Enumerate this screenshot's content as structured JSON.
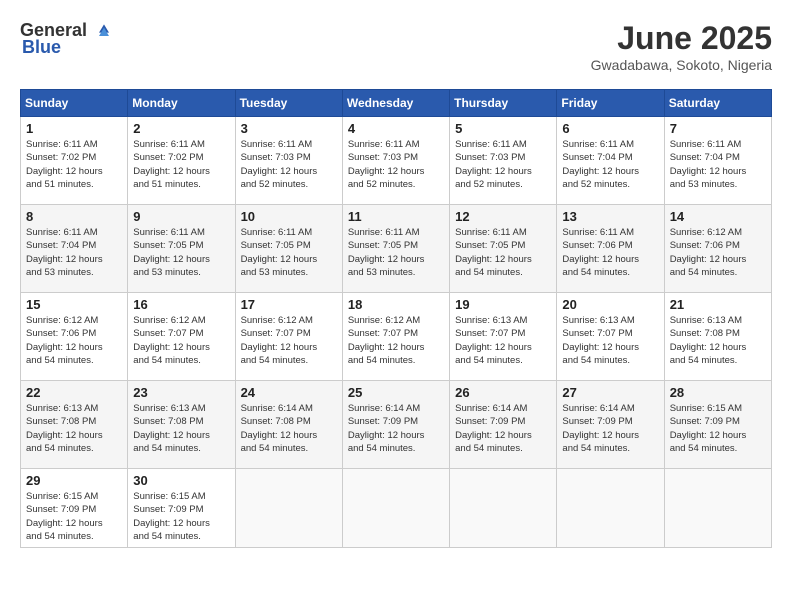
{
  "logo": {
    "general": "General",
    "blue": "Blue"
  },
  "title": "June 2025",
  "location": "Gwadabawa, Sokoto, Nigeria",
  "weekdays": [
    "Sunday",
    "Monday",
    "Tuesday",
    "Wednesday",
    "Thursday",
    "Friday",
    "Saturday"
  ],
  "weeks": [
    [
      {
        "day": "1",
        "info": "Sunrise: 6:11 AM\nSunset: 7:02 PM\nDaylight: 12 hours\nand 51 minutes."
      },
      {
        "day": "2",
        "info": "Sunrise: 6:11 AM\nSunset: 7:02 PM\nDaylight: 12 hours\nand 51 minutes."
      },
      {
        "day": "3",
        "info": "Sunrise: 6:11 AM\nSunset: 7:03 PM\nDaylight: 12 hours\nand 52 minutes."
      },
      {
        "day": "4",
        "info": "Sunrise: 6:11 AM\nSunset: 7:03 PM\nDaylight: 12 hours\nand 52 minutes."
      },
      {
        "day": "5",
        "info": "Sunrise: 6:11 AM\nSunset: 7:03 PM\nDaylight: 12 hours\nand 52 minutes."
      },
      {
        "day": "6",
        "info": "Sunrise: 6:11 AM\nSunset: 7:04 PM\nDaylight: 12 hours\nand 52 minutes."
      },
      {
        "day": "7",
        "info": "Sunrise: 6:11 AM\nSunset: 7:04 PM\nDaylight: 12 hours\nand 53 minutes."
      }
    ],
    [
      {
        "day": "8",
        "info": "Sunrise: 6:11 AM\nSunset: 7:04 PM\nDaylight: 12 hours\nand 53 minutes."
      },
      {
        "day": "9",
        "info": "Sunrise: 6:11 AM\nSunset: 7:05 PM\nDaylight: 12 hours\nand 53 minutes."
      },
      {
        "day": "10",
        "info": "Sunrise: 6:11 AM\nSunset: 7:05 PM\nDaylight: 12 hours\nand 53 minutes."
      },
      {
        "day": "11",
        "info": "Sunrise: 6:11 AM\nSunset: 7:05 PM\nDaylight: 12 hours\nand 53 minutes."
      },
      {
        "day": "12",
        "info": "Sunrise: 6:11 AM\nSunset: 7:05 PM\nDaylight: 12 hours\nand 54 minutes."
      },
      {
        "day": "13",
        "info": "Sunrise: 6:11 AM\nSunset: 7:06 PM\nDaylight: 12 hours\nand 54 minutes."
      },
      {
        "day": "14",
        "info": "Sunrise: 6:12 AM\nSunset: 7:06 PM\nDaylight: 12 hours\nand 54 minutes."
      }
    ],
    [
      {
        "day": "15",
        "info": "Sunrise: 6:12 AM\nSunset: 7:06 PM\nDaylight: 12 hours\nand 54 minutes."
      },
      {
        "day": "16",
        "info": "Sunrise: 6:12 AM\nSunset: 7:07 PM\nDaylight: 12 hours\nand 54 minutes."
      },
      {
        "day": "17",
        "info": "Sunrise: 6:12 AM\nSunset: 7:07 PM\nDaylight: 12 hours\nand 54 minutes."
      },
      {
        "day": "18",
        "info": "Sunrise: 6:12 AM\nSunset: 7:07 PM\nDaylight: 12 hours\nand 54 minutes."
      },
      {
        "day": "19",
        "info": "Sunrise: 6:13 AM\nSunset: 7:07 PM\nDaylight: 12 hours\nand 54 minutes."
      },
      {
        "day": "20",
        "info": "Sunrise: 6:13 AM\nSunset: 7:07 PM\nDaylight: 12 hours\nand 54 minutes."
      },
      {
        "day": "21",
        "info": "Sunrise: 6:13 AM\nSunset: 7:08 PM\nDaylight: 12 hours\nand 54 minutes."
      }
    ],
    [
      {
        "day": "22",
        "info": "Sunrise: 6:13 AM\nSunset: 7:08 PM\nDaylight: 12 hours\nand 54 minutes."
      },
      {
        "day": "23",
        "info": "Sunrise: 6:13 AM\nSunset: 7:08 PM\nDaylight: 12 hours\nand 54 minutes."
      },
      {
        "day": "24",
        "info": "Sunrise: 6:14 AM\nSunset: 7:08 PM\nDaylight: 12 hours\nand 54 minutes."
      },
      {
        "day": "25",
        "info": "Sunrise: 6:14 AM\nSunset: 7:09 PM\nDaylight: 12 hours\nand 54 minutes."
      },
      {
        "day": "26",
        "info": "Sunrise: 6:14 AM\nSunset: 7:09 PM\nDaylight: 12 hours\nand 54 minutes."
      },
      {
        "day": "27",
        "info": "Sunrise: 6:14 AM\nSunset: 7:09 PM\nDaylight: 12 hours\nand 54 minutes."
      },
      {
        "day": "28",
        "info": "Sunrise: 6:15 AM\nSunset: 7:09 PM\nDaylight: 12 hours\nand 54 minutes."
      }
    ],
    [
      {
        "day": "29",
        "info": "Sunrise: 6:15 AM\nSunset: 7:09 PM\nDaylight: 12 hours\nand 54 minutes."
      },
      {
        "day": "30",
        "info": "Sunrise: 6:15 AM\nSunset: 7:09 PM\nDaylight: 12 hours\nand 54 minutes."
      },
      {
        "day": "",
        "info": ""
      },
      {
        "day": "",
        "info": ""
      },
      {
        "day": "",
        "info": ""
      },
      {
        "day": "",
        "info": ""
      },
      {
        "day": "",
        "info": ""
      }
    ]
  ]
}
